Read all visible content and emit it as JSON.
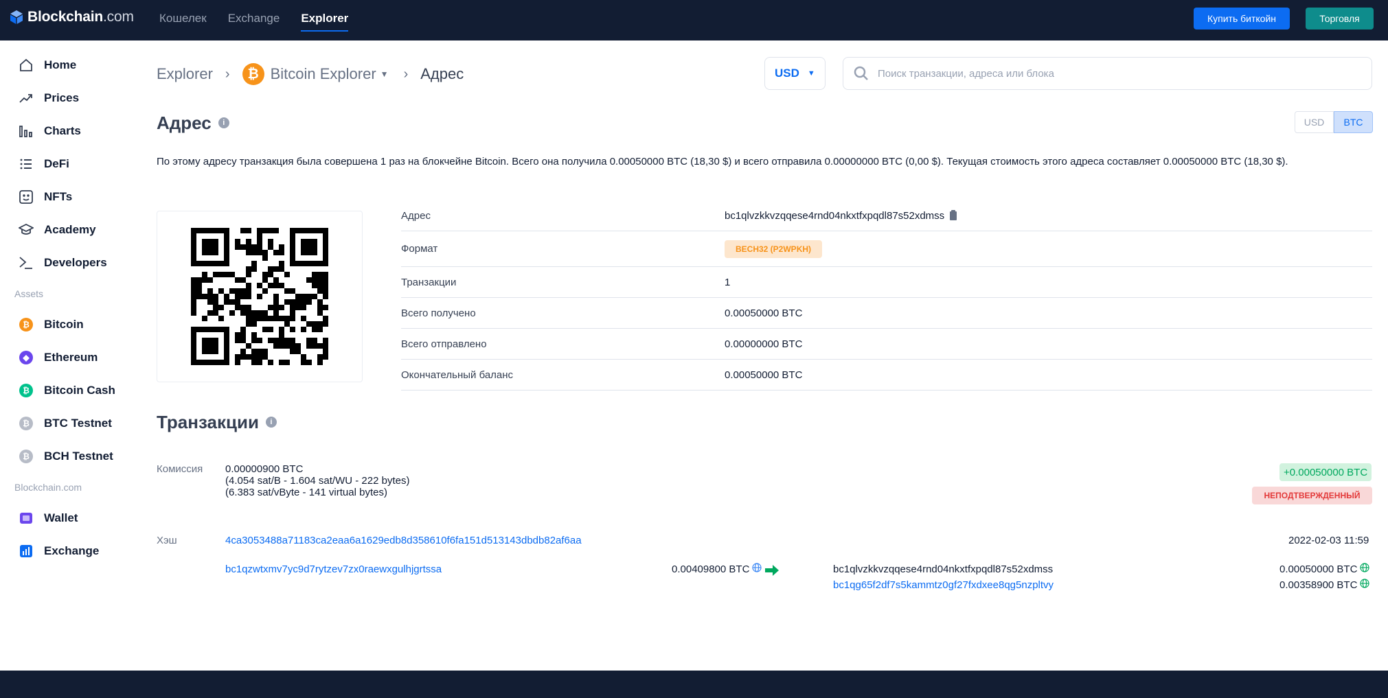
{
  "topbar": {
    "logo_main": "Blockchain",
    "logo_suffix": ".com",
    "nav": [
      "Кошелек",
      "Exchange",
      "Explorer"
    ],
    "buy_button": "Купить биткойн",
    "trade_button": "Торговля"
  },
  "sidebar": {
    "main_items": [
      "Home",
      "Prices",
      "Charts",
      "DeFi",
      "NFTs",
      "Academy",
      "Developers"
    ],
    "assets_title": "Assets",
    "assets": [
      "Bitcoin",
      "Ethereum",
      "Bitcoin Cash",
      "BTC Testnet",
      "BCH Testnet"
    ],
    "company_title": "Blockchain.com",
    "company": [
      "Wallet",
      "Exchange"
    ],
    "colors": {
      "bitcoin": "#f7931a",
      "ethereum": "#6b46ed",
      "bitcoin_cash": "#00c28c",
      "testnet": "#b7bcc7"
    }
  },
  "breadcrumb": {
    "root": "Explorer",
    "chain": "Bitcoin Explorer",
    "current": "Адрес"
  },
  "currency_select": "USD",
  "search": {
    "placeholder": "Поиск транзакции, адреса или блока"
  },
  "address_section": {
    "title": "Адрес",
    "toggle": [
      "USD",
      "BTC"
    ],
    "toggle_active": "BTC",
    "summary": "По этому адресу транзакция была совершена 1 раз на блокчейне Bitcoin. Всего она получила 0.00050000 BTC (18,30 $) и всего отправила 0.00000000 BTC (0,00 $). Текущая стоимость этого адреса составляет 0.00050000 BTC (18,30 $).",
    "rows": [
      {
        "label": "Адрес",
        "value": "bc1qlvzkkvzqqese4rnd04nkxtfxpqdl87s52xdmss"
      },
      {
        "label": "Формат",
        "value": "BECH32 (P2WPKH)"
      },
      {
        "label": "Транзакции",
        "value": "1"
      },
      {
        "label": "Всего получено",
        "value": "0.00050000 BTC"
      },
      {
        "label": "Всего отправлено",
        "value": "0.00000000 BTC"
      },
      {
        "label": "Окончательный баланс",
        "value": "0.00050000 BTC"
      }
    ]
  },
  "transactions": {
    "title": "Транзакции",
    "fee_label": "Комиссия",
    "fee_value": "0.00000900 BTC",
    "fee_detail_1": "(4.054 sat/B - 1.604 sat/WU - 222 bytes)",
    "fee_detail_2": "(6.383 sat/vByte - 141 virtual bytes)",
    "net_amount": "+0.00050000 BTC",
    "status": "НЕПОДТВЕРЖДЕННЫЙ",
    "hash_label": "Хэш",
    "hash": "4ca3053488a71183ca2eaa6a1629edb8d358610f6fa151d513143dbdb82af6aa",
    "timestamp": "2022-02-03 11:59",
    "input_address": "bc1qzwtxmv7yc9d7rytzev7zx0raewxgulhjgrtssa",
    "input_amount": "0.00409800 BTC",
    "outputs": [
      {
        "address": "bc1qlvzkkvzqqese4rnd04nkxtfxpqdl87s52xdmss",
        "amount": "0.00050000 BTC"
      },
      {
        "address": "bc1qg65f2df7s5kammtz0gf27fxdxee8qg5nzpltvy",
        "amount": "0.00358900 BTC"
      }
    ]
  }
}
